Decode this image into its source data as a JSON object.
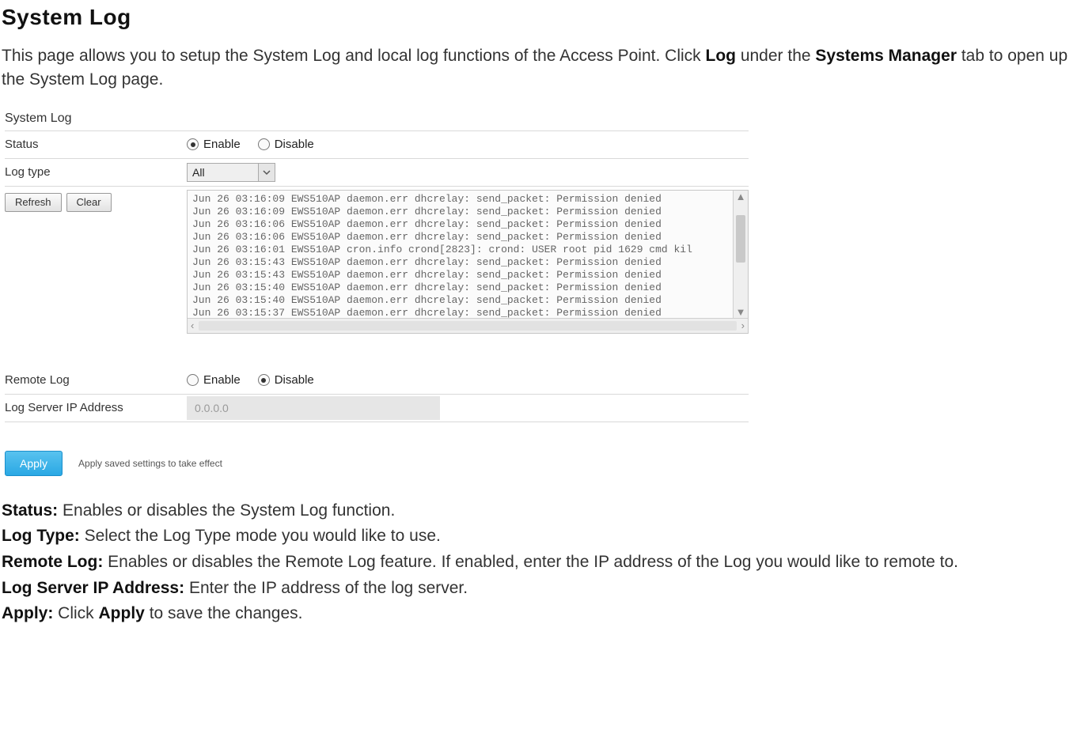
{
  "doc": {
    "title": "System Log",
    "intro_pre": "This page allows you to setup the System Log and local log functions of the Access Point. Click ",
    "intro_bold1": "Log",
    "intro_mid": " under the ",
    "intro_bold2": "Systems Manager",
    "intro_post": " tab to open up the System Log page."
  },
  "panel": {
    "section_title": "System Log",
    "status": {
      "label": "Status",
      "enable": "Enable",
      "disable": "Disable",
      "selected": "enable"
    },
    "logtype": {
      "label": "Log type",
      "value": "All"
    },
    "buttons": {
      "refresh": "Refresh",
      "clear": "Clear"
    },
    "log_lines": [
      "Jun 26 03:16:09 EWS510AP daemon.err dhcrelay: send_packet: Permission denied",
      "Jun 26 03:16:09 EWS510AP daemon.err dhcrelay: send_packet: Permission denied",
      "Jun 26 03:16:06 EWS510AP daemon.err dhcrelay: send_packet: Permission denied",
      "Jun 26 03:16:06 EWS510AP daemon.err dhcrelay: send_packet: Permission denied",
      "Jun 26 03:16:01 EWS510AP cron.info crond[2823]: crond: USER root pid 1629 cmd kil",
      "Jun 26 03:15:43 EWS510AP daemon.err dhcrelay: send_packet: Permission denied",
      "Jun 26 03:15:43 EWS510AP daemon.err dhcrelay: send_packet: Permission denied",
      "Jun 26 03:15:40 EWS510AP daemon.err dhcrelay: send_packet: Permission denied",
      "Jun 26 03:15:40 EWS510AP daemon.err dhcrelay: send_packet: Permission denied",
      "Jun 26 03:15:37 EWS510AP daemon.err dhcrelay: send_packet: Permission denied"
    ],
    "remote": {
      "label": "Remote Log",
      "enable": "Enable",
      "disable": "Disable",
      "selected": "disable"
    },
    "ip": {
      "label": "Log Server IP Address",
      "value": "0.0.0.0"
    },
    "apply": {
      "button": "Apply",
      "note": "Apply saved settings to take effect"
    }
  },
  "defs": {
    "status_t": "Status:",
    "status_d": " Enables or disables the System Log function.",
    "logtype_t": "Log Type:",
    "logtype_d": " Select the Log Type mode you would like to use.",
    "remote_t": "Remote Log:",
    "remote_d": " Enables or disables the Remote Log feature. If enabled, enter the IP address of the Log you would like to remote to.",
    "ip_t": "Log Server IP Address:",
    "ip_d": " Enter the IP address of the log server.",
    "apply_t": "Apply:",
    "apply_d1": " Click ",
    "apply_bold": "Apply",
    "apply_d2": " to save the changes."
  }
}
